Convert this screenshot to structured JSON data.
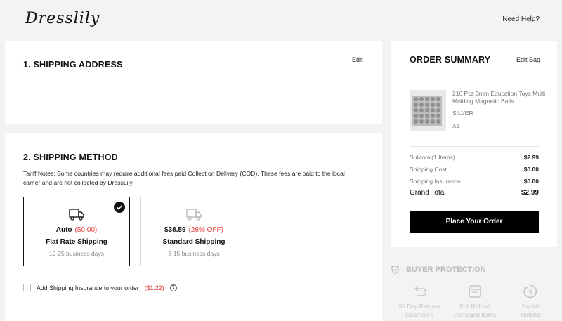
{
  "header": {
    "logo": "Dresslily",
    "help": "Need Help?"
  },
  "shipping_address": {
    "title": "1. SHIPPING ADDRESS",
    "edit": "Edit"
  },
  "shipping_method": {
    "title": "2. SHIPPING METHOD",
    "tariff_note": "Tariff Notes: Some countries may require additional fees paid Collect on Delivery (COD). These fees are paid to the local carrier and are not collected by DressLily.",
    "options": [
      {
        "price": "Auto",
        "price_note": "($0.00)",
        "name": "Flat Rate Shipping",
        "days": "12-25 business days",
        "selected": true
      },
      {
        "price": "$38.59",
        "price_note": "(26% OFF)",
        "name": "Standard Shipping",
        "days": "8-15 business days",
        "selected": false
      }
    ],
    "insurance": {
      "label": "Add Shipping Insurance to your order",
      "price": "($1.22)",
      "checked": false,
      "help_icon": "question-icon"
    }
  },
  "order_summary": {
    "title": "ORDER SUMMARY",
    "edit_bag": "Edit Bag",
    "product": {
      "name": "216 Pcs 3mm Education Toys Multi Molding Magnetic Balls",
      "color": "SILVER",
      "qty": "X1"
    },
    "lines": [
      {
        "label": "Subtotal(1 Items)",
        "value": "$2.99"
      },
      {
        "label": "Shipping Cost",
        "value": "$0.00"
      },
      {
        "label": "Shipping Insurance",
        "value": "$0.00"
      }
    ],
    "total": {
      "label": "Grand Total",
      "value": "$2.99"
    },
    "place_order": "Place Your Order"
  },
  "buyer_protection": {
    "title": "BUYER PROTECTION",
    "features": [
      {
        "line1": "30 Day Returns",
        "line2": "Guarantee",
        "icon": "return-arrow-icon"
      },
      {
        "line1": "Full Refund",
        "line2": "Damaged Items",
        "icon": "calendar-icon"
      },
      {
        "line1": "Partial",
        "line2": "Refund",
        "icon": "dollar-refund-icon"
      }
    ]
  },
  "colors": {
    "accent": "#e53935",
    "button": "#000000",
    "background": "#f3f3f3"
  }
}
